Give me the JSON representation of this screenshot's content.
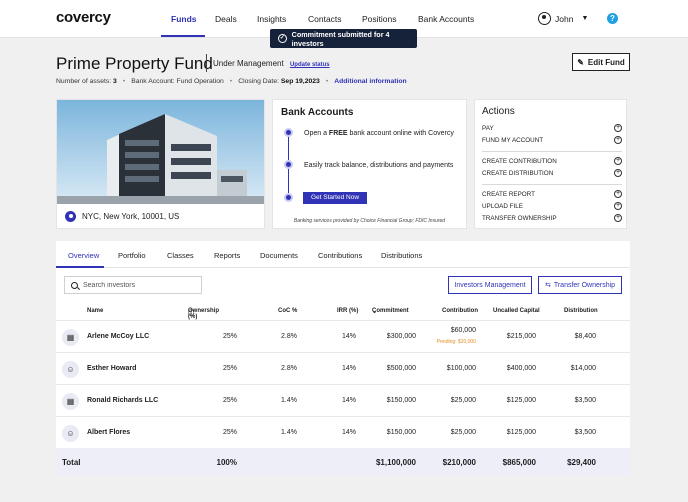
{
  "nav": {
    "logo": "covercy",
    "items": [
      "Funds",
      "Deals",
      "Insights",
      "Contacts",
      "Positions",
      "Bank Accounts"
    ],
    "user": "John"
  },
  "toast": "Commitment submitted for 4 investors",
  "fund": {
    "title": "Prime Property Fund",
    "status": "Under Management",
    "status_link": "Update status",
    "edit_label": "Edit Fund",
    "assets_label": "Number of assets:",
    "assets_value": "3",
    "bank_label": "Bank Account: Fund Operation",
    "closing_label": "Closing Date:",
    "closing_value": "Sep 19,2023",
    "additional": "Additional information",
    "location": "NYC, New York, 10001, US"
  },
  "bank": {
    "title": "Bank Accounts",
    "step1_pre": "Open a ",
    "step1_bold": "FREE",
    "step1_post": " bank account online with Covercy",
    "step2": "Easily track balance, distributions and payments",
    "cta": "Get Started Now",
    "footnote": "Banking services provided by Choice Financial Group; FDIC Insured"
  },
  "actions": {
    "title": "Actions",
    "items": [
      "PAY",
      "FUND MY ACCOUNT",
      "CREATE CONTRIBUTION",
      "CREATE DISTRIBUTION",
      "CREATE REPORT",
      "UPLOAD FILE",
      "TRANSFER OWNERSHIP"
    ]
  },
  "tabs": [
    "Overview",
    "Portfolio",
    "Classes",
    "Reports",
    "Documents",
    "Contributions",
    "Distributions"
  ],
  "search": {
    "placeholder": "Search investors"
  },
  "buttons": {
    "investors": "Investors Management",
    "transfer": "Transfer Ownership"
  },
  "table": {
    "headers": [
      "Name",
      "Ownership (%)",
      "CoC %",
      "IRR (%)",
      "Commitment",
      "Contribution",
      "Uncalled Capital",
      "Distribution"
    ],
    "rows": [
      {
        "type": "company",
        "name": "Arlene McCoy LLC",
        "ownership": "25%",
        "coc": "2.8%",
        "irr": "14%",
        "commitment": "$300,000",
        "contribution": "$60,000",
        "pending": "Pending: $20,000",
        "uncalled": "$215,000",
        "distribution": "$8,400"
      },
      {
        "type": "person",
        "name": "Esther Howard",
        "ownership": "25%",
        "coc": "2.8%",
        "irr": "14%",
        "commitment": "$500,000",
        "contribution": "$100,000",
        "pending": "",
        "uncalled": "$400,000",
        "distribution": "$14,000"
      },
      {
        "type": "company",
        "name": "Ronald Richards LLC",
        "ownership": "25%",
        "coc": "1.4%",
        "irr": "14%",
        "commitment": "$150,000",
        "contribution": "$25,000",
        "pending": "",
        "uncalled": "$125,000",
        "distribution": "$3,500"
      },
      {
        "type": "person",
        "name": "Albert Flores",
        "ownership": "25%",
        "coc": "1.4%",
        "irr": "14%",
        "commitment": "$150,000",
        "contribution": "$25,000",
        "pending": "",
        "uncalled": "$125,000",
        "distribution": "$3,500"
      }
    ],
    "total": {
      "label": "Total",
      "ownership": "100%",
      "commitment": "$1,100,000",
      "contribution": "$210,000",
      "uncalled": "$865,000",
      "distribution": "$29,400"
    }
  }
}
